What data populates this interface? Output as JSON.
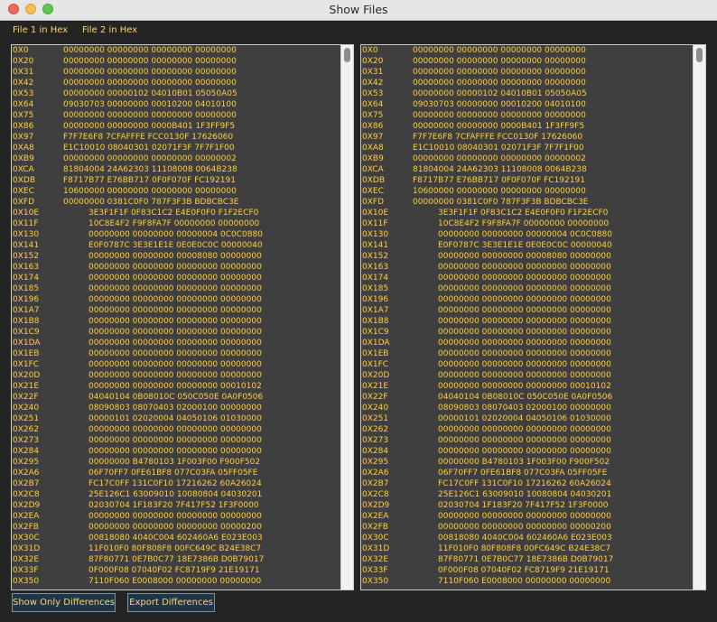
{
  "window": {
    "title": "Show Files"
  },
  "tabs": [
    {
      "label": "File 1 in Hex"
    },
    {
      "label": "File 2 in Hex"
    }
  ],
  "buttons": {
    "show_only_differences": "Show Only Differences",
    "export_differences": "Export Differences"
  },
  "rows": [
    {
      "addr": "0X0",
      "hex": "00000000 00000000 00000000 00000000"
    },
    {
      "addr": "0X20",
      "hex": "00000000 00000000 00000000 00000000"
    },
    {
      "addr": "0X31",
      "hex": "00000000 00000000 00000000 00000000"
    },
    {
      "addr": "0X42",
      "hex": "00000000 00000000 00000000 00000000"
    },
    {
      "addr": "0X53",
      "hex": "00000000 00000102 04010B01 05050A05"
    },
    {
      "addr": "0X64",
      "hex": "09030703 00000000 00010200 04010100"
    },
    {
      "addr": "0X75",
      "hex": "00000000 00000000 00000000 00000000"
    },
    {
      "addr": "0X86",
      "hex": "00000000 00000000 0000B401 1F3FF9F5"
    },
    {
      "addr": "0X97",
      "hex": "F7F7E6F8 7CFAFFFE FCC0130F 17626060"
    },
    {
      "addr": "0XA8",
      "hex": "E1C10010 08040301 02071F3F 7F7F1F00"
    },
    {
      "addr": "0XB9",
      "hex": "00000000 00000000 00000000 00000002"
    },
    {
      "addr": "0XCA",
      "hex": "81804004 24A62303 11108008 0064B238"
    },
    {
      "addr": "0XDB",
      "hex": "F8717B77 E76BB717 0F0F070F FC192191"
    },
    {
      "addr": "0XEC",
      "hex": "10600000 00000000 00000000 00000000"
    },
    {
      "addr": "0XFD",
      "hex": "00000000 0381C0F0 787F3F3B BDBCBC3E"
    },
    {
      "addr": "0X10E",
      "hex": "3E3F1F1F 0F83C1C2 E4E0F0F0 F1F2ECF0"
    },
    {
      "addr": "0X11F",
      "hex": "10C8E4F2 F9F8FA7F 00000000 00000000"
    },
    {
      "addr": "0X130",
      "hex": "00000000 00000000 00000004 0C0C0880"
    },
    {
      "addr": "0X141",
      "hex": "E0F0787C 3E3E1E1E 0E0E0C0C 00000040"
    },
    {
      "addr": "0X152",
      "hex": "00000000 00000000 00008080 00000000"
    },
    {
      "addr": "0X163",
      "hex": "00000000 00000000 00000000 00000000"
    },
    {
      "addr": "0X174",
      "hex": "00000000 00000000 00000000 00000000"
    },
    {
      "addr": "0X185",
      "hex": "00000000 00000000 00000000 00000000"
    },
    {
      "addr": "0X196",
      "hex": "00000000 00000000 00000000 00000000"
    },
    {
      "addr": "0X1A7",
      "hex": "00000000 00000000 00000000 00000000"
    },
    {
      "addr": "0X1B8",
      "hex": "00000000 00000000 00000000 00000000"
    },
    {
      "addr": "0X1C9",
      "hex": "00000000 00000000 00000000 00000000"
    },
    {
      "addr": "0X1DA",
      "hex": "00000000 00000000 00000000 00000000"
    },
    {
      "addr": "0X1EB",
      "hex": "00000000 00000000 00000000 00000000"
    },
    {
      "addr": "0X1FC",
      "hex": "00000000 00000000 00000000 00000000"
    },
    {
      "addr": "0X20D",
      "hex": "00000000 00000000 00000000 00000000"
    },
    {
      "addr": "0X21E",
      "hex": "00000000 00000000 00000000 00010102"
    },
    {
      "addr": "0X22F",
      "hex": "04040104 0B08010C 050C050E 0A0F0506"
    },
    {
      "addr": "0X240",
      "hex": "08090803 08070403 02000100 00000000"
    },
    {
      "addr": "0X251",
      "hex": "00000101 02020004 04050106 01030000"
    },
    {
      "addr": "0X262",
      "hex": "00000000 00000000 00000000 00000000"
    },
    {
      "addr": "0X273",
      "hex": "00000000 00000000 00000000 00000000"
    },
    {
      "addr": "0X284",
      "hex": "00000000 00000000 00000000 00000000"
    },
    {
      "addr": "0X295",
      "hex": "00000000 B4780103 1F003F00 F900F502"
    },
    {
      "addr": "0X2A6",
      "hex": "06F70FF7 0FE61BF8 077C03FA 05FF05FE"
    },
    {
      "addr": "0X2B7",
      "hex": "FC17C0FF 131C0F10 17216262 60A26024"
    },
    {
      "addr": "0X2C8",
      "hex": "25E126C1 63009010 10080804 04030201"
    },
    {
      "addr": "0X2D9",
      "hex": "02030704 1F183F20 7F417F52 1F3F0000"
    },
    {
      "addr": "0X2EA",
      "hex": "00000000 00000000 00000000 00000000"
    },
    {
      "addr": "0X2FB",
      "hex": "00000000 00000000 00000000 00000200"
    },
    {
      "addr": "0X30C",
      "hex": "00818080 4040C004 602460A6 E023E003"
    },
    {
      "addr": "0X31D",
      "hex": "11F010F0 80F808F8 00FC649C B24E38C7"
    },
    {
      "addr": "0X32E",
      "hex": "87F80771 0E7B0C77 18E7386B D0B79017"
    },
    {
      "addr": "0X33F",
      "hex": "0F000F08 07040F02 FC8719F9 21E19171"
    },
    {
      "addr": "0X350",
      "hex": "7110F060 E0008000 00000000 00000000"
    }
  ]
}
